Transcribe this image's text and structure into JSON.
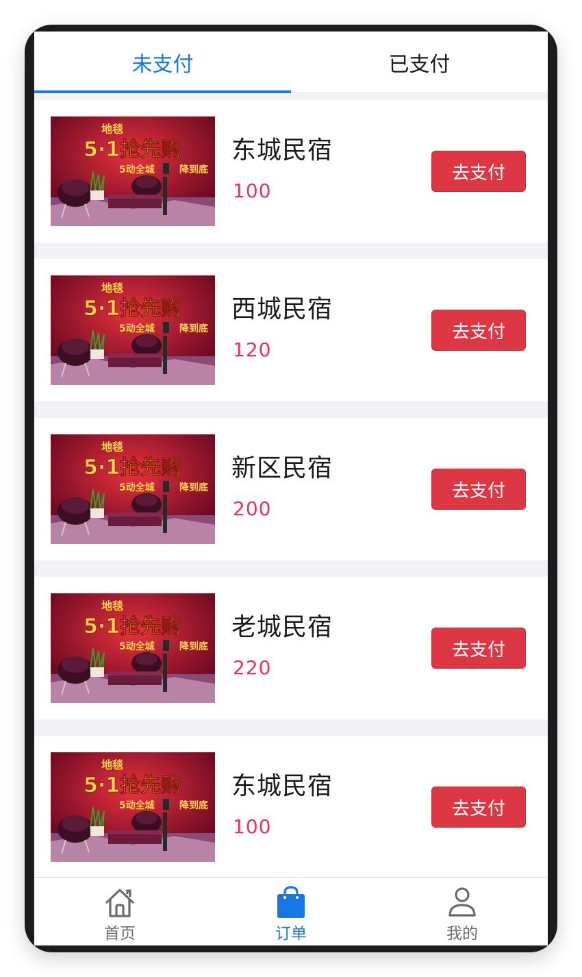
{
  "tabs": [
    {
      "label": "未支付",
      "active": true
    },
    {
      "label": "已支付",
      "active": false
    }
  ],
  "orders": [
    {
      "name": "东城民宿",
      "price": "100",
      "button": "去支付",
      "image": "carpet-sale-banner"
    },
    {
      "name": "西城民宿",
      "price": "120",
      "button": "去支付",
      "image": "carpet-sale-banner"
    },
    {
      "name": "新区民宿",
      "price": "200",
      "button": "去支付",
      "image": "carpet-sale-banner"
    },
    {
      "name": "老城民宿",
      "price": "220",
      "button": "去支付",
      "image": "carpet-sale-banner"
    },
    {
      "name": "东城民宿",
      "price": "100",
      "button": "去支付",
      "image": "carpet-sale-banner"
    }
  ],
  "banner": {
    "brand": "地毯",
    "headline": "5·1抢先购",
    "tagline": "5动全城",
    "slogan": "降到底"
  },
  "nav": [
    {
      "label": "首页",
      "icon": "home-icon",
      "active": false
    },
    {
      "label": "订单",
      "icon": "shopping-bag-icon",
      "active": true
    },
    {
      "label": "我的",
      "icon": "user-icon",
      "active": false
    }
  ],
  "colors": {
    "accent": "#1677e5",
    "price": "#ea3354",
    "button": "#de3744",
    "background": "#f2f2f7"
  }
}
